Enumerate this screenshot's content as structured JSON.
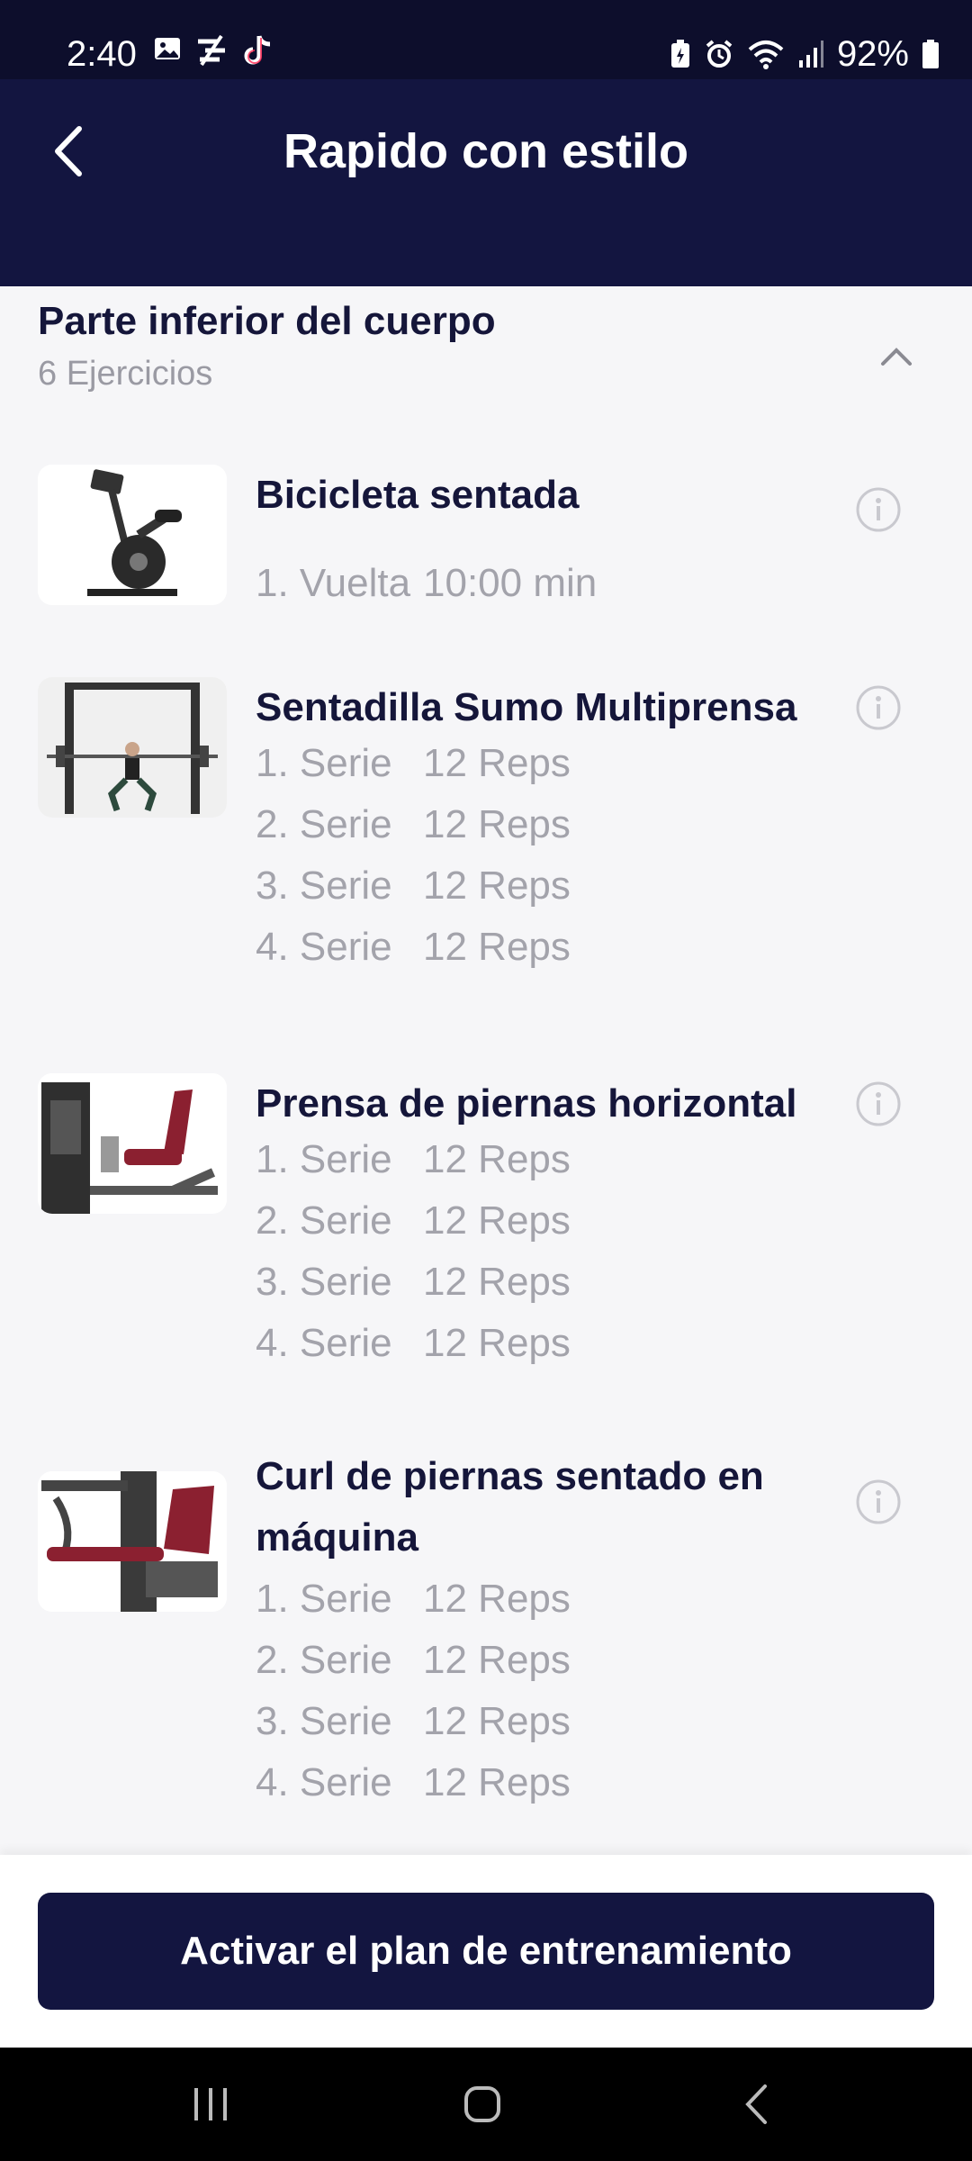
{
  "status_bar": {
    "time": "2:40",
    "battery": "92%",
    "left_icons": [
      "gallery-icon",
      "mute-fan-icon",
      "tiktok-icon"
    ],
    "right_icons": [
      "battery-saver-icon",
      "alarm-icon",
      "wifi-icon",
      "signal-icon",
      "battery-icon"
    ]
  },
  "header": {
    "title": "Rapido con estilo",
    "back_icon": "chevron-left-icon"
  },
  "section": {
    "title": "Parte inferior del cuerpo",
    "count": "6 Ejercicios",
    "collapse_icon": "chevron-up-icon"
  },
  "exercises": [
    {
      "name": "Bicicleta sentada",
      "sets": [
        {
          "label": "1. Vuelta",
          "value": "10:00 min"
        }
      ]
    },
    {
      "name": "Sentadilla Sumo Multiprensa",
      "sets": [
        {
          "label": "1. Serie",
          "value": "12 Reps"
        },
        {
          "label": "2. Serie",
          "value": "12 Reps"
        },
        {
          "label": "3. Serie",
          "value": "12 Reps"
        },
        {
          "label": "4. Serie",
          "value": "12 Reps"
        }
      ]
    },
    {
      "name": "Prensa de piernas horizontal",
      "sets": [
        {
          "label": "1. Serie",
          "value": "12 Reps"
        },
        {
          "label": "2. Serie",
          "value": "12 Reps"
        },
        {
          "label": "3. Serie",
          "value": "12 Reps"
        },
        {
          "label": "4. Serie",
          "value": "12 Reps"
        }
      ]
    },
    {
      "name": "Curl de piernas sentado en máquina",
      "sets": [
        {
          "label": "1. Serie",
          "value": "12 Reps"
        },
        {
          "label": "2. Serie",
          "value": "12 Reps"
        },
        {
          "label": "3. Serie",
          "value": "12 Reps"
        },
        {
          "label": "4. Serie",
          "value": "12 Reps"
        }
      ]
    }
  ],
  "footer": {
    "cta_label": "Activar el plan de entrenamiento"
  },
  "nav": {
    "icons": [
      "recent-apps-icon",
      "home-icon",
      "back-icon"
    ]
  },
  "colors": {
    "header_bg": "#131540",
    "status_bg": "#0d0e2c",
    "title_text": "#15163a",
    "muted_text": "#a3a3ab",
    "page_bg": "#f6f6f8"
  }
}
